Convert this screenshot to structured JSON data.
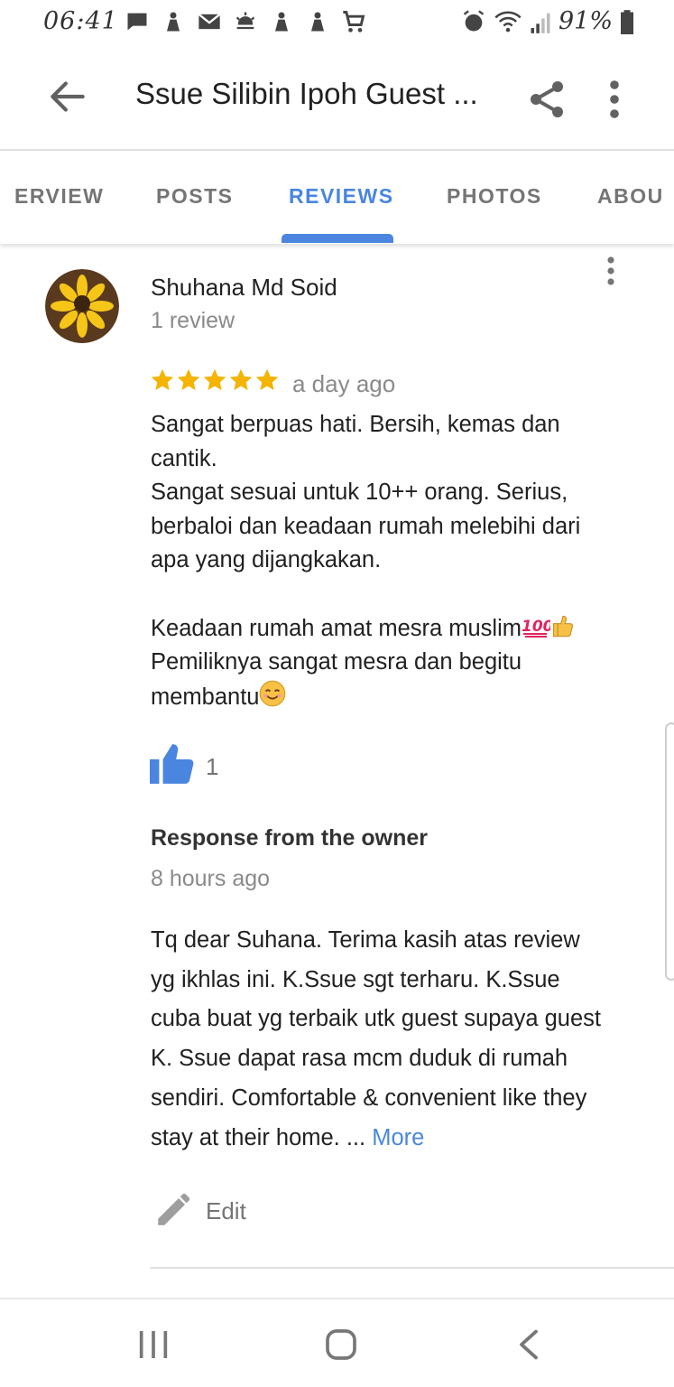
{
  "status_bar": {
    "time": "06:41",
    "battery": "91%"
  },
  "app_bar": {
    "title": "Ssue Silibin Ipoh Guest ..."
  },
  "tabs": [
    {
      "label": "ERVIEW",
      "active": false
    },
    {
      "label": "POSTS",
      "active": false
    },
    {
      "label": "REVIEWS",
      "active": true
    },
    {
      "label": "PHOTOS",
      "active": false
    },
    {
      "label": "ABOU",
      "active": false
    }
  ],
  "review": {
    "reviewer_name": "Shuhana Md Soid",
    "reviewer_count": "1 review",
    "rating": 5,
    "date": "a day ago",
    "body_lines": [
      "Sangat berpuas hati. Bersih, kemas dan",
      "cantik.",
      "Sangat sesuai untuk 10++ orang. Serius,",
      "berbaloi dan keadaan rumah melebihi dari",
      "apa yang dijangkakan.",
      "",
      "Keadaan rumah amat mesra muslim",
      "Pemiliknya sangat mesra dan begitu",
      "membantu"
    ],
    "like_count": "1"
  },
  "owner_response": {
    "heading": "Response from the owner",
    "date": "8 hours ago",
    "body_lines": [
      "Tq dear Suhana. Terima kasih atas review",
      "yg ikhlas ini. K.Ssue sgt terharu. K.Ssue",
      "cuba buat yg terbaik utk guest supaya guest",
      "K. Ssue dapat rasa mcm duduk di rumah",
      "sendiri. Comfortable & convenient like they",
      "stay at their home. ... "
    ],
    "more_label": "More"
  },
  "edit_label": "Edit",
  "colors": {
    "accent": "#4a86e0",
    "star": "#f4b400",
    "secondary_text": "#8a8a8a"
  },
  "icons": {
    "back": "arrow-left-icon",
    "share": "share-icon",
    "more": "more-vert-icon",
    "like": "thumbs-up-icon",
    "edit": "pencil-icon"
  }
}
